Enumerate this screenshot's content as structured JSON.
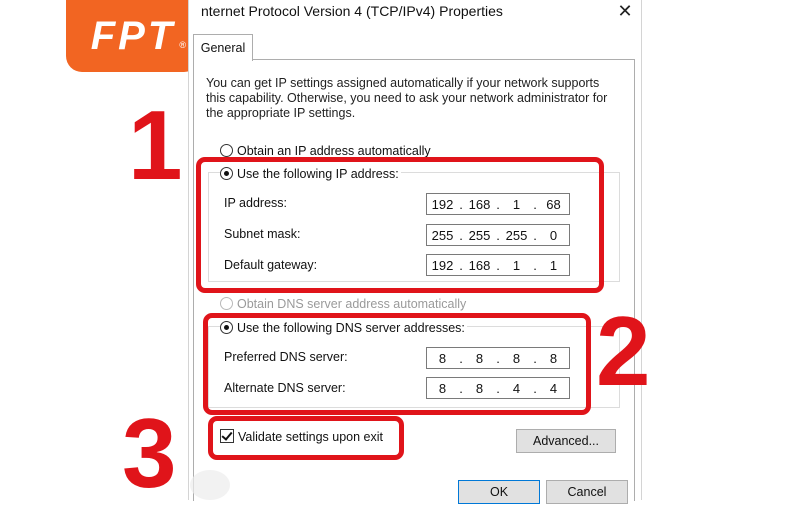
{
  "logo": {
    "text": "FPT",
    "mark": "®"
  },
  "window": {
    "title": "nternet Protocol Version 4 (TCP/IPv4) Properties",
    "close_glyph": "✕"
  },
  "tabs": [
    {
      "label": "General",
      "active": true
    }
  ],
  "info_text": "You can get IP settings assigned automatically if your network supports this capability. Otherwise, you need to ask your network administrator for the appropriate IP settings.",
  "ip_section": {
    "auto_label": "Obtain an IP address automatically",
    "manual_label": "Use the following IP address:",
    "selected": "manual",
    "fields": [
      {
        "label": "IP address:",
        "octets": [
          "192",
          "168",
          "1",
          "68"
        ]
      },
      {
        "label": "Subnet mask:",
        "octets": [
          "255",
          "255",
          "255",
          "0"
        ]
      },
      {
        "label": "Default gateway:",
        "octets": [
          "192",
          "168",
          "1",
          "1"
        ]
      }
    ]
  },
  "dns_section": {
    "auto_label": "Obtain DNS server address automatically",
    "manual_label": "Use the following DNS server addresses:",
    "selected": "manual",
    "fields": [
      {
        "label": "Preferred DNS server:",
        "octets": [
          "8",
          "8",
          "8",
          "8"
        ]
      },
      {
        "label": "Alternate DNS server:",
        "octets": [
          "8",
          "8",
          "4",
          "4"
        ]
      }
    ]
  },
  "validate_label": "Validate settings upon exit",
  "validate_checked": true,
  "buttons": {
    "advanced": "Advanced...",
    "ok": "OK",
    "cancel": "Cancel"
  },
  "annotations": {
    "n1": "1",
    "n2": "2",
    "n3": "3"
  },
  "colors": {
    "annotation_red": "#e0141a",
    "logo_orange": "#f26522"
  }
}
